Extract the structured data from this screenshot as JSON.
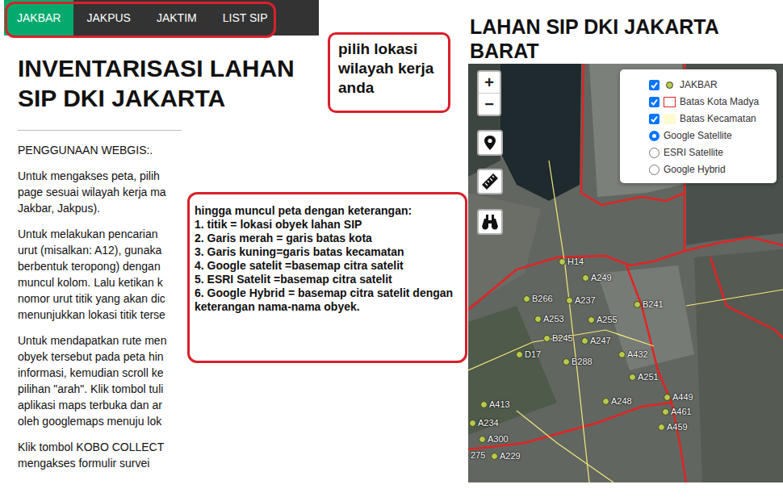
{
  "nav": [
    {
      "label": "JAKBAR",
      "selected": true
    },
    {
      "label": "JAKPUS",
      "selected": false
    },
    {
      "label": "JAKTIM",
      "selected": false
    },
    {
      "label": "LIST SIP",
      "selected": false
    }
  ],
  "heading": "INVENTARISASI LAHAN SIP DKI JAKARTA",
  "paragraphs": [
    [
      "PENGGUNAAN WEBGIS:."
    ],
    [
      "Untuk mengakses peta, pilih",
      "page sesuai wilayah kerja ma",
      "Jakbar, Jakpus)."
    ],
    [
      "Untuk melakukan pencarian",
      "urut (misalkan: A12), gunaka",
      "berbentuk teropong) dengan",
      "muncul kolom. Lalu ketikan k",
      "nomor urut titik yang akan dic",
      "menunjukkan lokasi titik terse"
    ],
    [
      "Untuk mendapatkan rute men",
      "obyek tersebut pada peta hin",
      "informasi, kemudian scroll ke",
      "pilihan \"arah\". Klik tombol tuli",
      "aplikasi maps terbuka dan ar",
      "oleh googlemaps menuju lok"
    ],
    [
      "Klik tombol KOBO COLLECT",
      "mengakses formulir survei"
    ]
  ],
  "callouts": {
    "nav_hint": "pilih lokasi wilayah kerja anda",
    "legend_intro": "hingga muncul peta dengan keterangan:",
    "legend_items": [
      "1. titik = lokasi obyek lahan SIP",
      "2. Garis merah = garis batas kota",
      "3. Garis kuning=garis batas kecamatan",
      "4. Google satelit =basemap citra satelit",
      "5. ESRI Satelit =basemap citra satelit",
      "6. Google Hybrid = basemap citra satelit dengan keterangan nama-nama obyek."
    ]
  },
  "map": {
    "title": "LAHAN SIP DKI JAKARTA BARAT",
    "zoom_in": "+",
    "zoom_out": "−",
    "layers": [
      {
        "label": "JAKBAR",
        "kind": "checkbox",
        "checked": true,
        "color": "#b9c94f"
      },
      {
        "label": "Batas Kota Madya",
        "kind": "checkbox",
        "checked": true,
        "color": "#e02424"
      },
      {
        "label": "Batas Kecamatan",
        "kind": "checkbox",
        "checked": true,
        "color": "#fdfbd0"
      },
      {
        "label": "Google Satellite",
        "kind": "radio",
        "selected": true
      },
      {
        "label": "ESRI Satellite",
        "kind": "radio",
        "selected": false
      },
      {
        "label": "Google Hybrid",
        "kind": "radio",
        "selected": false
      }
    ],
    "points": [
      "H14",
      "A249",
      "B266",
      "A237",
      "B241",
      "A253",
      "A255",
      "B245",
      "A247",
      "D17",
      "B288",
      "A432",
      "A251",
      "A449",
      "A248",
      "A461",
      "A413",
      "A234",
      "A459",
      "A300",
      "275",
      "A229"
    ]
  }
}
